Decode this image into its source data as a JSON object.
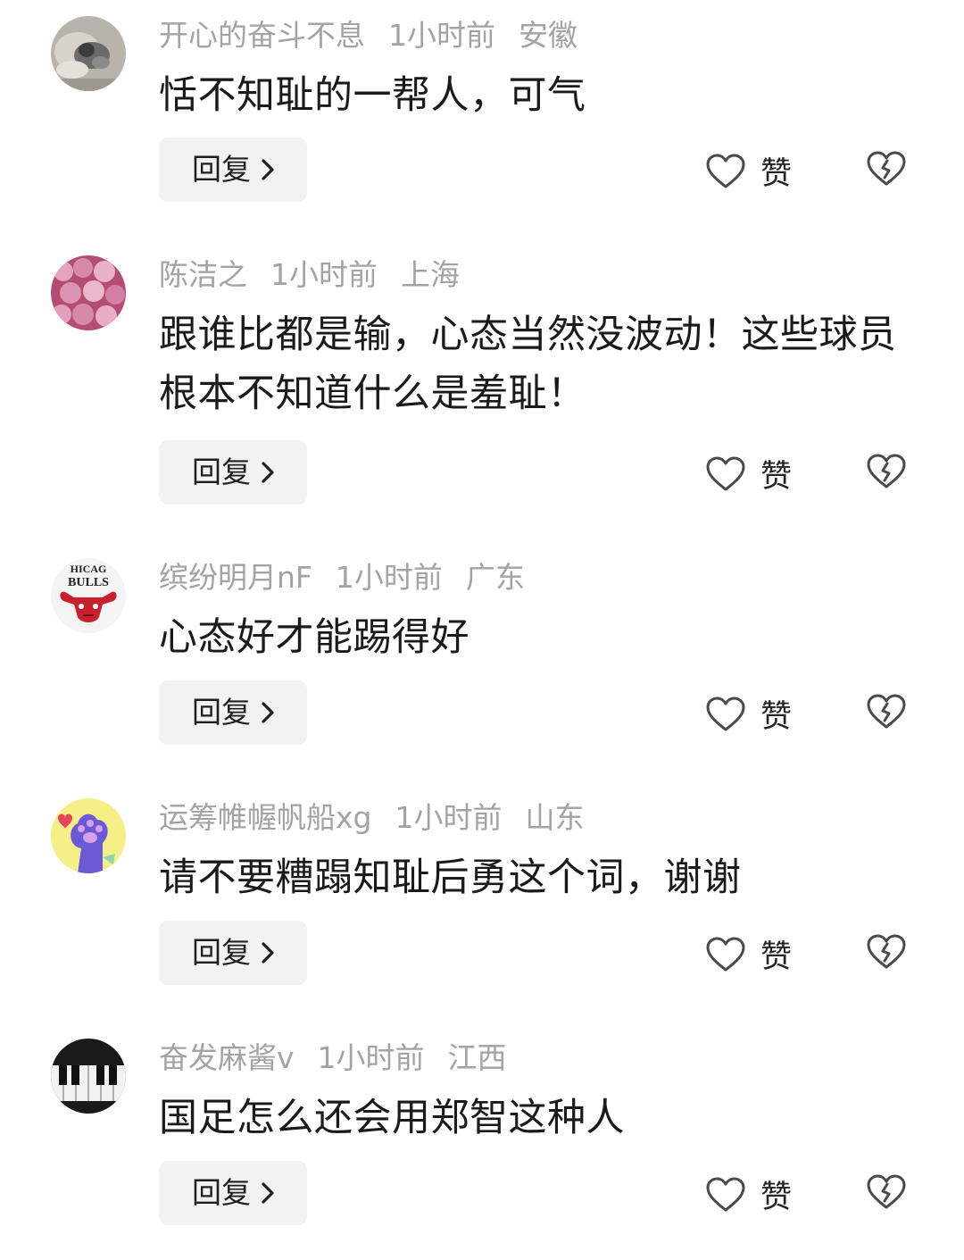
{
  "comments": [
    {
      "author": "开心的奋斗不息",
      "time": "1小时前",
      "location": "安徽",
      "text": "恬不知耻的一帮人，可气",
      "avatar": "cat-avatar",
      "reply_label": "回复",
      "like_label": "赞"
    },
    {
      "author": "陈洁之",
      "time": "1小时前",
      "location": "上海",
      "text": "跟谁比都是输，心态当然没波动！这些球员根本不知道什么是羞耻！",
      "avatar": "berries-avatar",
      "reply_label": "回复",
      "like_label": "赞"
    },
    {
      "author": "缤纷明月nF",
      "time": "1小时前",
      "location": "广东",
      "text": "心态好才能踢得好",
      "avatar": "bulls-logo-avatar",
      "avatar_text": [
        "HICAG",
        "BULLS"
      ],
      "reply_label": "回复",
      "like_label": "赞"
    },
    {
      "author": "运筹帷幄帆船xg",
      "time": "1小时前",
      "location": "山东",
      "text": "请不要糟蹋知耻后勇这个词，谢谢",
      "avatar": "paw-avatar",
      "reply_label": "回复",
      "like_label": "赞"
    },
    {
      "author": "奋发麻酱v",
      "time": "1小时前",
      "location": "江西",
      "text": "国足怎么还会用郑智这种人",
      "avatar": "piano-keys-avatar",
      "reply_label": "回复",
      "like_label": "赞"
    }
  ],
  "colors": {
    "meta_text": "#a3a3a3",
    "body_text": "#1a1a1a",
    "reply_bg": "#f2f2f2",
    "icon_stroke": "#4a4a4a"
  }
}
